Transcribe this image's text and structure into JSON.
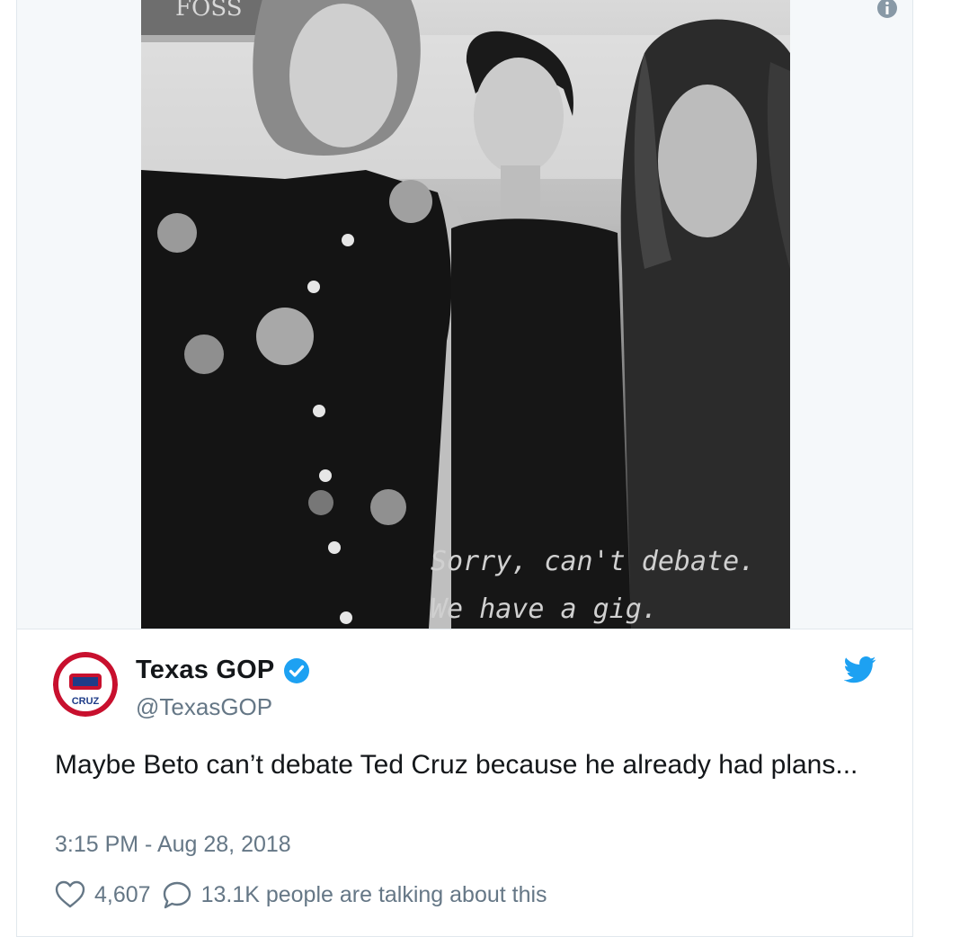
{
  "media": {
    "photo_alt": "Black and white photo of three young men",
    "sign_text": "FOSS",
    "caption_line1": "Sorry, can't debate.",
    "caption_line2": "We have a gig.",
    "info_icon": "info-icon"
  },
  "author": {
    "name": "Texas GOP",
    "handle": "@TexasGOP",
    "verified": true,
    "verified_icon": "verified-badge-icon",
    "avatar_icon": "republican-party-logo",
    "avatar_text": "CRUZ"
  },
  "tweet": {
    "text": "Maybe Beto can’t debate Ted Cruz because he already had plans...",
    "timestamp": "3:15 PM - Aug 28, 2018"
  },
  "actions": {
    "likes": "4,607",
    "talking": "13.1K people are talking about this"
  },
  "colors": {
    "brand_blue": "#1da1f2",
    "text_primary": "#14171a",
    "text_secondary": "#657786",
    "border": "#e1e8ed"
  }
}
